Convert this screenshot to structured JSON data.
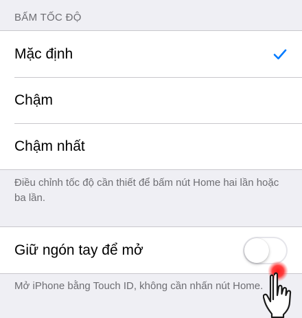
{
  "speed_section": {
    "header": "BẤM TỐC ĐỘ",
    "options": [
      {
        "label": "Mặc định",
        "selected": true
      },
      {
        "label": "Chậm",
        "selected": false
      },
      {
        "label": "Chậm nhất",
        "selected": false
      }
    ],
    "footnote": "Điều chỉnh tốc độ cần thiết để bấm nút Home hai lần hoặc ba lần."
  },
  "rest_finger": {
    "label": "Giữ ngón tay để mở",
    "toggle_on": false,
    "footnote": "Mở iPhone bằng Touch ID, không cần nhấn nút Home."
  },
  "colors": {
    "accent": "#007aff",
    "background": "#efeff4",
    "secondary_text": "#6d6d72",
    "separator": "#c8c7cc",
    "touch_indicator": "#ff1a1a"
  },
  "icons": {
    "checkmark": "checkmark-icon",
    "touch": "hand-pointer-icon"
  }
}
